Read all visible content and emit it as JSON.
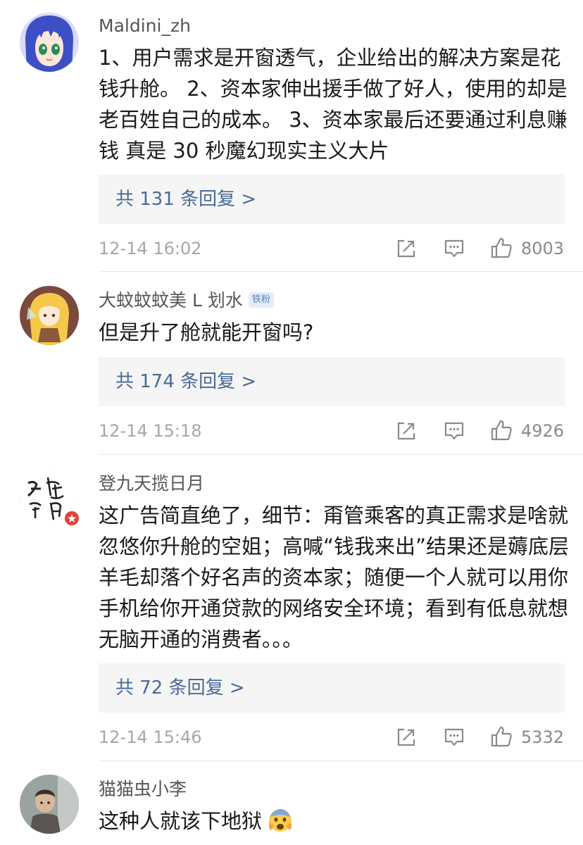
{
  "comments": [
    {
      "username": "Maldini_zh",
      "text": "1、用户需求是开窗透气，企业给出的解决方案是花钱升舱。 2、资本家伸出援手做了好人，使用的却是老百姓自己的成本。 3、资本家最后还要通过利息赚钱 真是 30 秒魔幻现实主义大片",
      "replies": "共 131 条回复 >",
      "timestamp": "12-14 16:02",
      "likes": "8003"
    },
    {
      "username": "大蚊蚊蚊美 L 划水",
      "badge": "铁粉",
      "text": "但是升了舱就能开窗吗?",
      "replies": "共 174 条回复 >",
      "timestamp": "12-14 15:18",
      "likes": "4926"
    },
    {
      "username": "登九天揽日月",
      "text": "这广告简直绝了，细节：甭管乘客的真正需求是啥就忽悠你升舱的空姐；高喊“钱我来出”结果还是薅底层羊毛却落个好名声的资本家；随便一个人就可以用你手机给你开通贷款的网络安全环境；看到有低息就想无脑开通的消费者。。。",
      "replies": "共 72 条回复 >",
      "timestamp": "12-14 15:46",
      "likes": "5332"
    },
    {
      "username": "猫猫虫小李",
      "text": "这种人就该下地狱",
      "emoji": "fearful-face-emoji"
    }
  ],
  "colors": {
    "link": "#4a6a98",
    "username": "#555555",
    "meta": "#a6a6a6",
    "reply_bg": "#f5f5f5",
    "badge_bg": "#e4ecf7",
    "badge_text": "#5b84c4"
  },
  "icons": [
    "share-icon",
    "comment-icon",
    "thumbs-up-icon"
  ]
}
